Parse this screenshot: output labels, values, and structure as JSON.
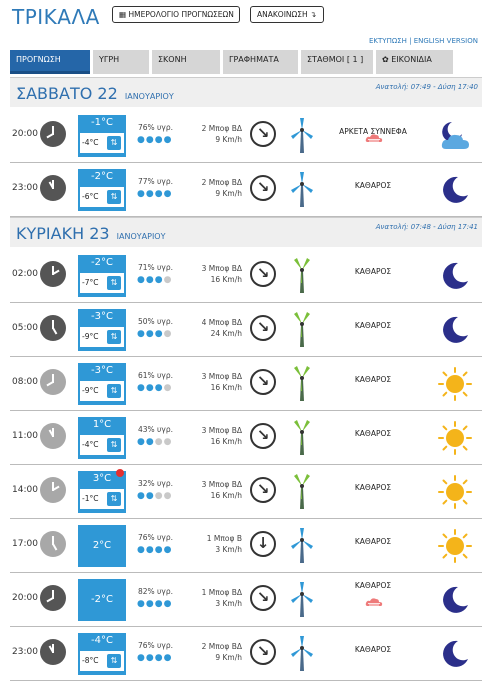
{
  "header": {
    "city": "ΤΡΙΚΑΛΑ",
    "calendar_button": "ΗΜΕΡΟΛΟΓΙΟ ΠΡΟΓΝΩΣΕΩΝ",
    "announcement_button": "ΑΝΑΚΟΙΝΩΣΗ",
    "print_link": "ΕΚΤΥΠΩΣΗ",
    "english_link": "ENGLISH VERSION"
  },
  "tabs": [
    "ΠΡΟΓΝΩΣΗ",
    "ΥΓΡΗ",
    "ΣΚΟΝΗ",
    "ΓΡΑΦΗΜΑΤΑ",
    "ΣΤΑΘΜΟΙ [ 1 ]",
    "ΕΙΚΟΝΙΔΙΑ"
  ],
  "days": [
    {
      "name": "ΣΑΒΒΑΤΟ 22",
      "month": "ΙΑΝΟΥΑΡΙΟΥ",
      "sun": "Ανατολή: 07:49 - Δύση 17:40",
      "rows": [
        {
          "time": "20:00",
          "tmax": "-1°C",
          "tmin": "-4°C",
          "hum": "76% υγρ.",
          "drops": 4,
          "wind1": "2 Μποφ ΒΔ",
          "wind2": "9 Km/h",
          "cond": "ΑΡΚΕΤΑ ΣΥΝΝΕΦΑ",
          "icon": "moon-cloud-icon"
        },
        {
          "time": "23:00",
          "tmax": "-2°C",
          "tmin": "-6°C",
          "hum": "77% υγρ.",
          "drops": 4,
          "wind1": "2 Μποφ ΒΔ",
          "wind2": "9 Km/h",
          "cond": "ΚΑΘΑΡΟΣ",
          "icon": "moon-icon"
        }
      ]
    },
    {
      "name": "ΚΥΡΙΑΚΗ 23",
      "month": "ΙΑΝΟΥΑΡΙΟΥ",
      "sun": "Ανατολή: 07:48 - Δύση 17:41",
      "rows": [
        {
          "time": "02:00",
          "tmax": "-2°C",
          "tmin": "-7°C",
          "hum": "71% υγρ.",
          "drops": 3,
          "wind1": "3 Μποφ ΒΔ",
          "wind2": "16 Km/h",
          "cond": "ΚΑΘΑΡΟΣ",
          "icon": "moon-icon"
        },
        {
          "time": "05:00",
          "tmax": "-3°C",
          "tmin": "-9°C",
          "hum": "50% υγρ.",
          "drops": 3,
          "wind1": "4 Μποφ ΒΔ",
          "wind2": "24 Km/h",
          "cond": "ΚΑΘΑΡΟΣ",
          "icon": "moon-icon"
        },
        {
          "time": "08:00",
          "tmax": "-3°C",
          "tmin": "-9°C",
          "hum": "61% υγρ.",
          "drops": 3,
          "wind1": "3 Μποφ ΒΔ",
          "wind2": "16 Km/h",
          "cond": "ΚΑΘΑΡΟΣ",
          "icon": "sun-icon"
        },
        {
          "time": "11:00",
          "tmax": "1°C",
          "tmin": "-4°C",
          "hum": "43% υγρ.",
          "drops": 2,
          "wind1": "3 Μποφ ΒΔ",
          "wind2": "16 Km/h",
          "cond": "ΚΑΘΑΡΟΣ",
          "icon": "sun-icon"
        },
        {
          "time": "14:00",
          "tmax": "3°C",
          "tmin": "-1°C",
          "hum": "32% υγρ.",
          "drops": 2,
          "wind1": "3 Μποφ ΒΔ",
          "wind2": "16 Km/h",
          "cond": "ΚΑΘΑΡΟΣ",
          "icon": "sun-icon"
        },
        {
          "time": "17:00",
          "tmax": "2°C",
          "tmin": "",
          "hum": "76% υγρ.",
          "drops": 4,
          "wind1": "1 Μποφ Β",
          "wind2": "3 Km/h",
          "cond": "ΚΑΘΑΡΟΣ",
          "icon": "sun-icon"
        },
        {
          "time": "20:00",
          "tmax": "-2°C",
          "tmin": "",
          "hum": "82% υγρ.",
          "drops": 4,
          "wind1": "1 Μποφ ΒΔ",
          "wind2": "3 Km/h",
          "cond": "ΚΑΘΑΡΟΣ",
          "icon": "moon-icon"
        },
        {
          "time": "23:00",
          "tmax": "-4°C",
          "tmin": "-8°C",
          "hum": "76% υγρ.",
          "drops": 4,
          "wind1": "2 Μποφ ΒΔ",
          "wind2": "9 Km/h",
          "cond": "ΚΑΘΑΡΟΣ",
          "icon": "moon-icon"
        }
      ]
    }
  ],
  "colors": {
    "accent": "#2f7ab8",
    "tab_active": "#2566a8",
    "temp_box": "#2f98d6",
    "sun": "#f4b41a",
    "moon": "#2b2f8a"
  }
}
